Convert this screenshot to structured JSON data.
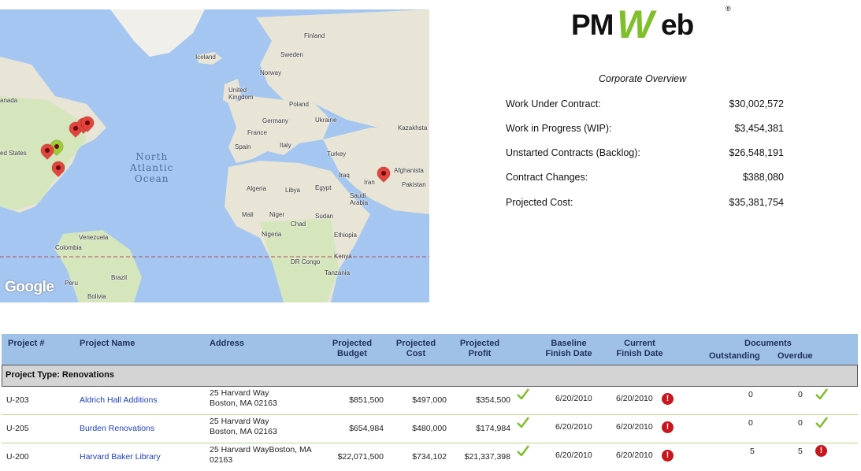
{
  "map": {
    "labels": [
      "Finland",
      "Iceland",
      "Sweden",
      "Norway",
      "United Kingdom",
      "Poland",
      "Germany",
      "Ukraine",
      "Kazakhsta",
      "France",
      "Spain",
      "Italy",
      "Turkey",
      "Afghanista",
      "Pakistan",
      "Iraq",
      "Iran",
      "Saudi Arabia",
      "Egypt",
      "Libya",
      "Algeria",
      "Mali",
      "Niger",
      "Sudan",
      "Chad",
      "Nigeria",
      "Ethiopia",
      "Kenya",
      "DR Congo",
      "Tanzania",
      "Venezuela",
      "Colombia",
      "Peru",
      "Brazil",
      "Bolivia",
      "anada",
      "ed States"
    ],
    "ocean_label": [
      "North",
      "Atlantic",
      "Ocean"
    ],
    "provider": "Google"
  },
  "brand": {
    "left": "PM",
    "w": "W",
    "right": "eb",
    "reg": "®"
  },
  "overview": {
    "title": "Corporate Overview",
    "rows": [
      {
        "label": "Work Under Contract:",
        "value": "$30,002,572"
      },
      {
        "label": "Work in Progress  (WIP):",
        "value": "$3,454,381"
      },
      {
        "label": "Unstarted Contracts (Backlog):",
        "value": "$26,548,191"
      },
      {
        "label": "Contract Changes:",
        "value": "$388,080"
      },
      {
        "label": "Projected Cost:",
        "value": "$35,381,754"
      }
    ]
  },
  "table": {
    "headers": {
      "project_no": "Project #",
      "project_name": "Project Name",
      "address": "Address",
      "budget": [
        "Projected",
        "Budget"
      ],
      "cost": [
        "Projected",
        "Cost"
      ],
      "profit": [
        "Projected",
        "Profit"
      ],
      "baseline": [
        "Baseline",
        "Finish Date"
      ],
      "current": [
        "Current",
        "Finish Date"
      ],
      "documents": "Documents",
      "outstanding": "Outstanding",
      "overdue": "Overdue"
    },
    "group": "Project Type:  Renovations",
    "rows": [
      {
        "no": "U-203",
        "name": "Aldrich Hall Additions",
        "addr1": "25 Harvard Way",
        "addr2": "Boston, MA 02163",
        "budget": "$851,500",
        "cost": "$497,000",
        "profit": "$354,500",
        "profit_status": "ok",
        "baseline": "6/20/2010",
        "current": "6/20/2010",
        "current_status": "alert",
        "outstanding": "0",
        "overdue": "0",
        "doc_status": "ok"
      },
      {
        "no": "U-205",
        "name": "Burden Renovations",
        "addr1": "25 Harvard Way",
        "addr2": "Boston, MA 02163",
        "budget": "$654,984",
        "cost": "$480,000",
        "profit": "$174,984",
        "profit_status": "ok",
        "baseline": "6/20/2010",
        "current": "6/20/2010",
        "current_status": "alert",
        "outstanding": "0",
        "overdue": "0",
        "doc_status": "ok"
      },
      {
        "no": "U-200",
        "name": "Harvard Baker Library",
        "addr1": "25 Harvard WayBoston, MA",
        "addr2": "02163",
        "budget": "$22,071,500",
        "cost": "$734,102",
        "profit": "$21,337,398",
        "profit_status": "ok",
        "baseline": "6/20/2010",
        "current": "6/20/2010",
        "current_status": "alert",
        "outstanding": "5",
        "overdue": "5",
        "doc_status": "alert"
      }
    ]
  },
  "colors": {
    "ok": "#7fbf2a",
    "alert": "#c8161c",
    "header_bg": "#9fc1e8",
    "link": "#1f3fbf"
  }
}
